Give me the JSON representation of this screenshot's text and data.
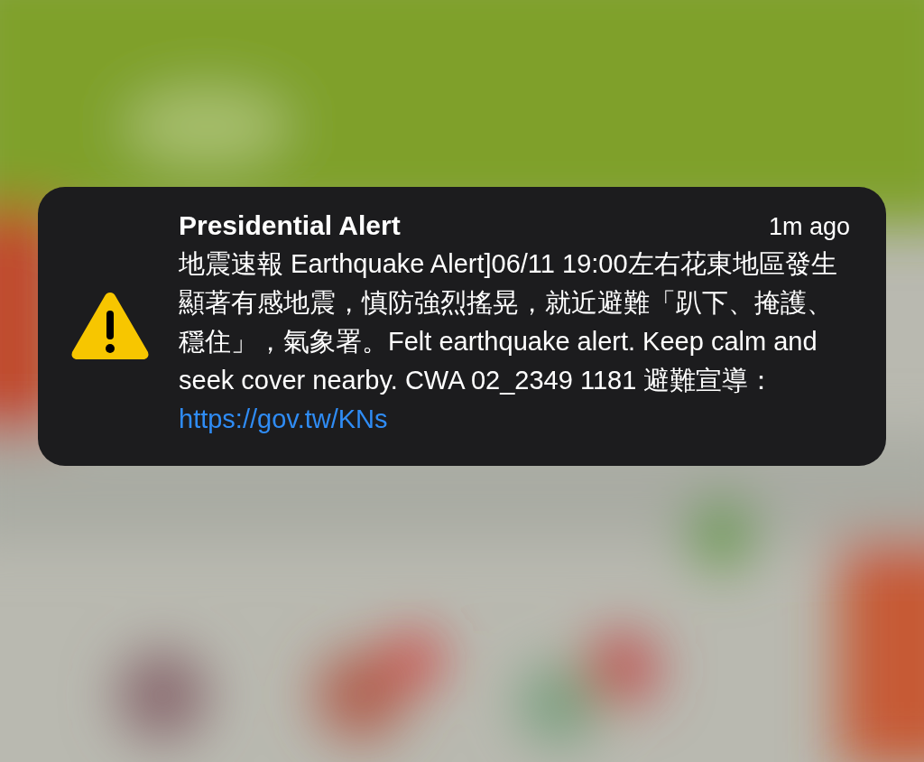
{
  "notification": {
    "title": "Presidential Alert",
    "time": "1m ago",
    "message": "地震速報 Earthquake Alert]06/11 19:00左右花東地區發生顯著有感地震，慎防強烈搖晃，就近避難「趴下、掩護、穩住」，氣象署。Felt earthquake alert. Keep calm and seek cover nearby. CWA 02_2349 1181 避難宣導：",
    "link": "https://gov.tw/KNs"
  }
}
